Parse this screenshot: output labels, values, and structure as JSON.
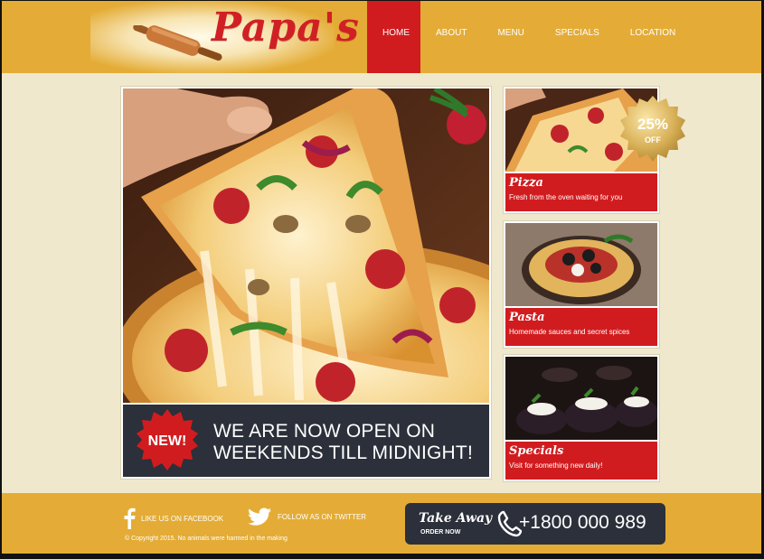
{
  "brand": {
    "name": "Papa's"
  },
  "nav": {
    "items": [
      "HOME",
      "ABOUT",
      "MENU",
      "SPECIALS",
      "LOCATION"
    ]
  },
  "hero": {
    "badge": "NEW!",
    "line1": "WE ARE NOW OPEN ON",
    "line2": "WEEKENDS TILL MIDNIGHT!"
  },
  "promo": {
    "percent": "25%",
    "off": "OFF"
  },
  "cards": [
    {
      "title": "Pizza",
      "desc": "Fresh from the oven waiting for you"
    },
    {
      "title": "Pasta",
      "desc": "Homemade sauces and secret spices"
    },
    {
      "title": "Specials",
      "desc": "Visit for something new daily!"
    }
  ],
  "footer": {
    "facebook": "LIKE US ON FACEBOOK",
    "twitter": "FOLLOW AS ON TWITTER",
    "copyright": "© Copyright 2015. No animals were harmed in the making",
    "takeaway_title": "Take Away",
    "takeaway_sub": "ORDER NOW",
    "phone": "+1800 000 989"
  },
  "colors": {
    "accent": "#d11c1f",
    "gold": "#e4ac36",
    "dark": "#2b303a",
    "cream": "#efe8cc"
  },
  "icons": [
    "rolling-pin-icon",
    "facebook-icon",
    "twitter-icon",
    "phone-icon"
  ]
}
